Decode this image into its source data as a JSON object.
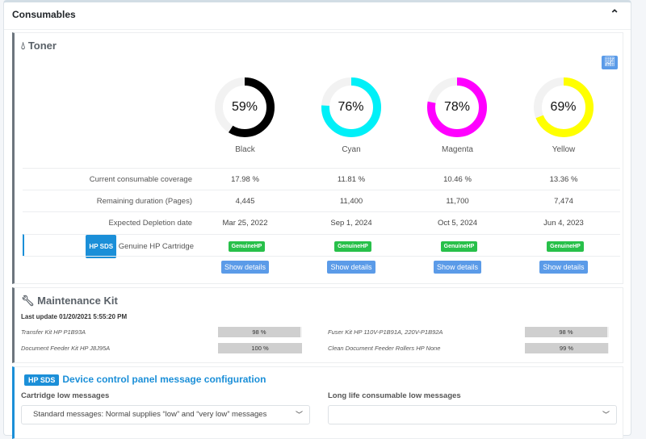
{
  "title": "Consumables",
  "toner": {
    "title": "Toner",
    "row_labels": {
      "coverage": "Current consumable coverage",
      "remaining": "Remaining duration (Pages)",
      "depletion": "Expected Depletion date",
      "genuine": "Genuine HP Cartridge"
    },
    "hp_sds": "HP SDS",
    "columns": [
      {
        "name": "Black",
        "percent": 59,
        "pct_label": "59%",
        "color": "#000000",
        "coverage": "17.98 %",
        "remaining": "4,445",
        "depletion": "Mar 25, 2022",
        "genuine": "GenuineHP",
        "details": "Show details"
      },
      {
        "name": "Cyan",
        "percent": 76,
        "pct_label": "76%",
        "color": "#00f0f8",
        "coverage": "11.81 %",
        "remaining": "11,400",
        "depletion": "Sep 1, 2024",
        "genuine": "GenuineHP",
        "details": "Show details"
      },
      {
        "name": "Magenta",
        "percent": 78,
        "pct_label": "78%",
        "color": "#ff00ff",
        "coverage": "10.46 %",
        "remaining": "11,700",
        "depletion": "Oct 5, 2024",
        "genuine": "GenuineHP",
        "details": "Show details"
      },
      {
        "name": "Yellow",
        "percent": 69,
        "pct_label": "69%",
        "color": "#ffff00",
        "coverage": "13.36 %",
        "remaining": "7,474",
        "depletion": "Jun 4, 2023",
        "genuine": "GenuineHP",
        "details": "Show details"
      }
    ]
  },
  "maintenance": {
    "title": "Maintenance Kit",
    "last_update": "Last update 01/20/2021 5:55:20 PM",
    "items": [
      {
        "name": "Transfer Kit HP P1B93A",
        "percent": 98,
        "label": "98 %"
      },
      {
        "name": "Fuser Kit HP 110V-P1B91A, 220V-P1B92A",
        "percent": 98,
        "label": "98 %"
      },
      {
        "name": "Document Feeder Kit HP J8J95A",
        "percent": 100,
        "label": "100 %"
      },
      {
        "name": "Clean Document Feeder Rollers HP None",
        "percent": 99,
        "label": "99 %"
      }
    ]
  },
  "device": {
    "hp_sds": "HP SDS",
    "title": "Device control panel message configuration",
    "cartridge_label": "Cartridge low messages",
    "cartridge_value": "Standard messages: Normal supplies “low” and “very low” messages",
    "longlife_label": "Long life consumable low messages",
    "longlife_value": ""
  }
}
